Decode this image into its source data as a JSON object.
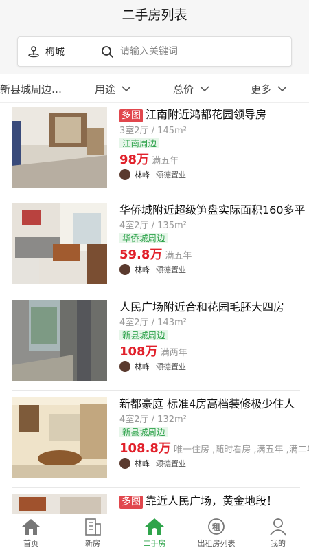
{
  "page_title": "二手房列表",
  "search": {
    "city": "梅城",
    "placeholder": "请输入关键词"
  },
  "filters": [
    "新县城周边…",
    "用途",
    "总价",
    "更多"
  ],
  "listings": [
    {
      "badge": "多图",
      "title": "江南附近鸿都花园领导房",
      "meta": "3室2厅 / 145m²",
      "area": "江南周边",
      "price": "98万",
      "note": "满五年",
      "agent": "林峰",
      "agency": "颂德置业"
    },
    {
      "badge": "",
      "title": "华侨城附近超级笋盘实际面积160多平",
      "meta": "4室2厅 / 135m²",
      "area": "华侨城周边",
      "price": "59.8万",
      "note": "满五年",
      "agent": "林峰",
      "agency": "颂德置业"
    },
    {
      "badge": "",
      "title": "人民广场附近合和花园毛胚大四房",
      "meta": "4室2厅 / 143m²",
      "area": "新县城周边",
      "price": "108万",
      "note": "满两年",
      "agent": "林峰",
      "agency": "颂德置业"
    },
    {
      "badge": "",
      "title": "新都豪庭 标准4房高档装修极少住人",
      "meta": "4室2厅 / 132m²",
      "area": "新县城周边",
      "price": "108.8万",
      "note": "唯一住房 ,随时看房 ,满五年 ,满二年",
      "agent": "林峰",
      "agency": "颂德置业"
    },
    {
      "badge": "多图",
      "title": "靠近人民广场，黄金地段！"
    }
  ],
  "tabs": [
    {
      "label": "首页",
      "icon": "home-icon"
    },
    {
      "label": "新房",
      "icon": "building-icon"
    },
    {
      "label": "二手房",
      "icon": "house-icon"
    },
    {
      "label": "出租房列表",
      "icon": "rent-icon"
    },
    {
      "label": "我的",
      "icon": "user-icon"
    }
  ],
  "colors": {
    "accent": "#2fa44b",
    "price": "#e1212b",
    "badge": "#e1474d",
    "area_tag_bg": "#e7f6ea"
  }
}
